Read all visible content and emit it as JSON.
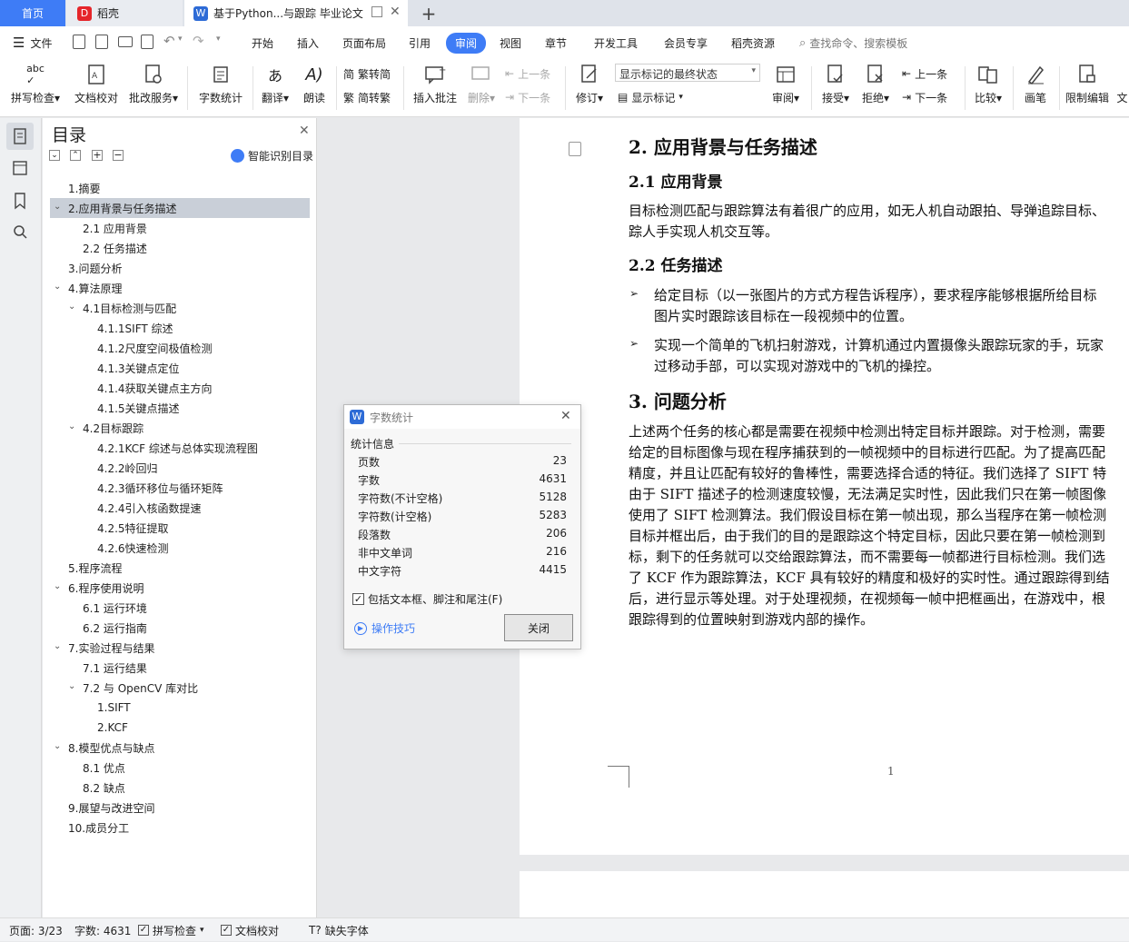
{
  "tabs": {
    "home": "首页",
    "daoke": "稻壳",
    "doc": "基于Python...与跟踪 毕业论文",
    "add": "+"
  },
  "menubar": {
    "file": "文件",
    "items": [
      "开始",
      "插入",
      "页面布局",
      "引用",
      "审阅",
      "视图",
      "章节",
      "开发工具",
      "会员专享",
      "稻壳资源"
    ],
    "active": "审阅",
    "search": "查找命令、搜索模板"
  },
  "ribbon": {
    "spell": "拼写检查",
    "proof": "文档校对",
    "batch": "批改服务",
    "wordcount": "字数统计",
    "translate": "翻译",
    "read": "朗读",
    "to_trad": "繁转简",
    "to_simp": "简转繁",
    "insert_comment": "插入批注",
    "delete": "删除",
    "prev": "上一条",
    "next": "下一条",
    "revise": "修订",
    "markup_select": "显示标记的最终状态",
    "show_markup": "显示标记",
    "review": "审阅",
    "accept": "接受",
    "reject": "拒绝",
    "prev2": "上一条",
    "next2": "下一条",
    "compare": "比较",
    "pen": "画笔",
    "restrict": "限制编辑",
    "doc_cut": "文"
  },
  "toc": {
    "title": "目录",
    "smart": "智能识别目录",
    "items": [
      {
        "label": "1.摘要",
        "level": 0,
        "caret": false
      },
      {
        "label": "2.应用背景与任务描述",
        "level": 0,
        "caret": true,
        "selected": true
      },
      {
        "label": "2.1 应用背景",
        "level": 1,
        "caret": false
      },
      {
        "label": "2.2 任务描述",
        "level": 1,
        "caret": false
      },
      {
        "label": "3.问题分析",
        "level": 0,
        "caret": false
      },
      {
        "label": "4.算法原理",
        "level": 0,
        "caret": true
      },
      {
        "label": "4.1目标检测与匹配",
        "level": 1,
        "caret": true
      },
      {
        "label": "4.1.1SIFT 综述",
        "level": 2,
        "caret": false
      },
      {
        "label": "4.1.2尺度空间极值检测",
        "level": 2,
        "caret": false
      },
      {
        "label": "4.1.3关键点定位",
        "level": 2,
        "caret": false
      },
      {
        "label": "4.1.4获取关键点主方向",
        "level": 2,
        "caret": false
      },
      {
        "label": "4.1.5关键点描述",
        "level": 2,
        "caret": false
      },
      {
        "label": "4.2目标跟踪",
        "level": 1,
        "caret": true
      },
      {
        "label": "4.2.1KCF 综述与总体实现流程图",
        "level": 2,
        "caret": false
      },
      {
        "label": "4.2.2岭回归",
        "level": 2,
        "caret": false
      },
      {
        "label": "4.2.3循环移位与循环矩阵",
        "level": 2,
        "caret": false
      },
      {
        "label": "4.2.4引入核函数提速",
        "level": 2,
        "caret": false
      },
      {
        "label": "4.2.5特征提取",
        "level": 2,
        "caret": false
      },
      {
        "label": "4.2.6快速检测",
        "level": 2,
        "caret": false
      },
      {
        "label": "5.程序流程",
        "level": 0,
        "caret": false
      },
      {
        "label": "6.程序使用说明",
        "level": 0,
        "caret": true
      },
      {
        "label": "6.1 运行环境",
        "level": 1,
        "caret": false
      },
      {
        "label": "6.2 运行指南",
        "level": 1,
        "caret": false
      },
      {
        "label": "7.实验过程与结果",
        "level": 0,
        "caret": true
      },
      {
        "label": "7.1 运行结果",
        "level": 1,
        "caret": false
      },
      {
        "label": "7.2 与 OpenCV 库对比",
        "level": 1,
        "caret": true
      },
      {
        "label": "1.SIFT",
        "level": 2,
        "caret": false
      },
      {
        "label": "2.KCF",
        "level": 2,
        "caret": false
      },
      {
        "label": "8.模型优点与缺点",
        "level": 0,
        "caret": true
      },
      {
        "label": "8.1 优点",
        "level": 1,
        "caret": false
      },
      {
        "label": "8.2 缺点",
        "level": 1,
        "caret": false
      },
      {
        "label": "9.展望与改进空间",
        "level": 0,
        "caret": false
      },
      {
        "label": "10.成员分工",
        "level": 0,
        "caret": false
      }
    ]
  },
  "document": {
    "h2": "2. 应用背景与任务描述",
    "h21": "2.1 应用背景",
    "p1": [
      "目标检测匹配与跟踪算法有着很广的应用，如无人机自动跟拍、导弹追踪目标、",
      "踪人手实现人机交互等。"
    ],
    "h22": "2.2 任务描述",
    "bullet1": [
      "给定目标（以一张图片的方式方程告诉程序），要求程序能够根据所给目标",
      "图片实时跟踪该目标在一段视频中的位置。"
    ],
    "bullet2": [
      "实现一个简单的飞机扫射游戏，计算机通过内置摄像头跟踪玩家的手，玩家",
      "过移动手部，可以实现对游戏中的飞机的操控。"
    ],
    "h3": "3. 问题分析",
    "p3": [
      "上述两个任务的核心都是需要在视频中检测出特定目标并跟踪。对于检测，需要",
      "给定的目标图像与现在程序捕获到的一帧视频中的目标进行匹配。为了提高匹配",
      "精度，并且让匹配有较好的鲁棒性，需要选择合适的特征。我们选择了 SIFT 特",
      "由于 SIFT 描述子的检测速度较慢，无法满足实时性，因此我们只在第一帧图像",
      "使用了 SIFT 检测算法。我们假设目标在第一帧出现，那么当程序在第一帧检测",
      "目标并框出后，由于我们的目的是跟踪这个特定目标，因此只要在第一帧检测到",
      "标，剩下的任务就可以交给跟踪算法，而不需要每一帧都进行目标检测。我们选",
      "了 KCF 作为跟踪算法，KCF 具有较好的精度和极好的实时性。通过跟踪得到结",
      "后，进行显示等处理。对于处理视频，在视频每一帧中把框画出，在游戏中，根",
      "跟踪得到的位置映射到游戏内部的操作。"
    ],
    "page_number": "1"
  },
  "dialog": {
    "title": "字数统计",
    "section": "统计信息",
    "rows": [
      {
        "label": "页数",
        "value": "23"
      },
      {
        "label": "字数",
        "value": "4631"
      },
      {
        "label": "字符数(不计空格)",
        "value": "5128"
      },
      {
        "label": "字符数(计空格)",
        "value": "5283"
      },
      {
        "label": "段落数",
        "value": "206"
      },
      {
        "label": "非中文单词",
        "value": "216"
      },
      {
        "label": "中文字符",
        "value": "4415"
      }
    ],
    "checkbox": "包括文本框、脚注和尾注(F)",
    "tips": "操作技巧",
    "close": "关闭"
  },
  "status": {
    "page": "页面: 3/23",
    "words": "字数: 4631",
    "spell": "拼写检查",
    "proof": "文档校对",
    "font": "缺失字体"
  },
  "colors": {
    "accent": "#3e7cf6",
    "selected_row": "#c9cfd8"
  }
}
